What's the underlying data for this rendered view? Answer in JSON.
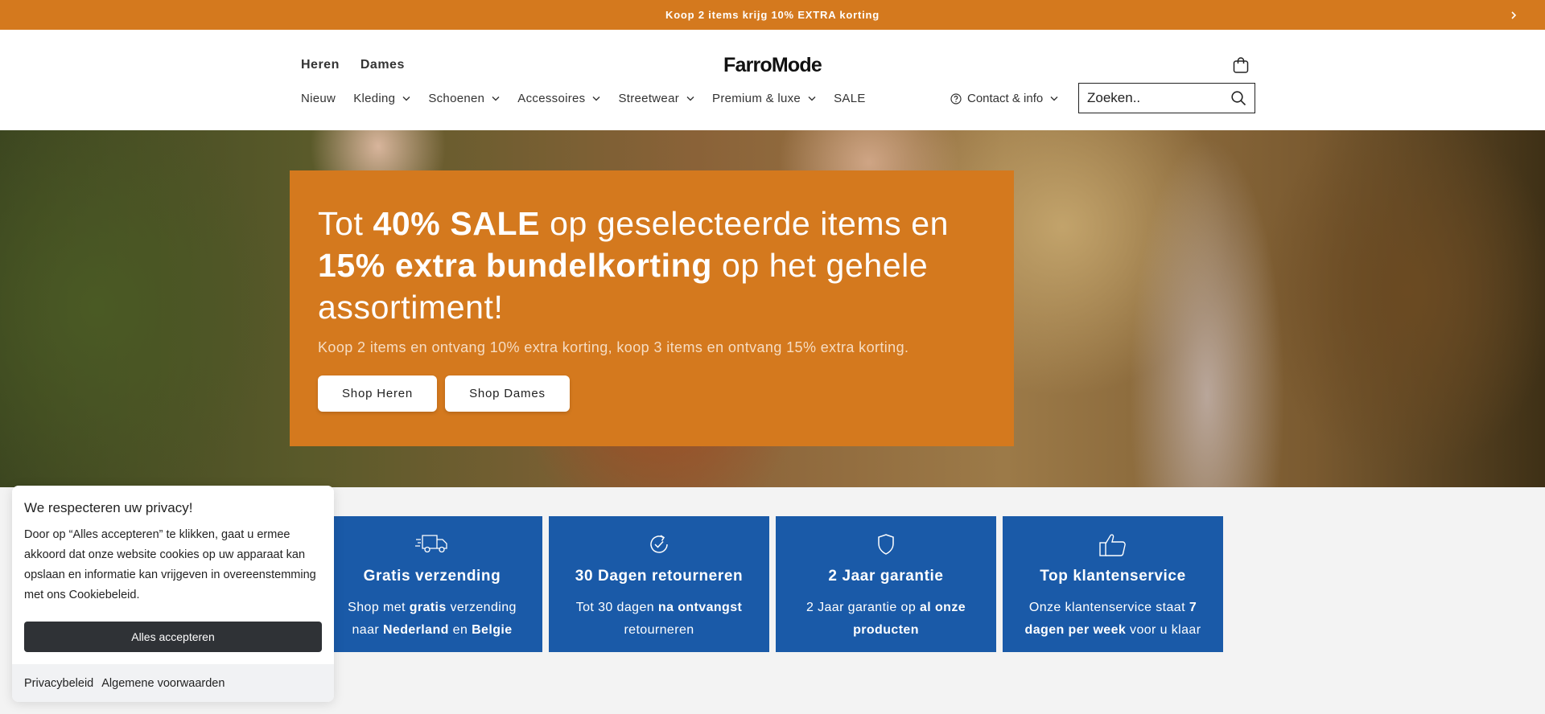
{
  "announcement": {
    "text": "Koop 2 items krijg 10% EXTRA korting",
    "next_icon": "chevron-right-icon"
  },
  "header": {
    "gender_links": [
      "Heren",
      "Dames"
    ],
    "logo": "FarroMode",
    "nav": [
      "Nieuw",
      "Kleding",
      "Schoenen",
      "Accessoires",
      "Streetwear",
      "Premium & luxe",
      "SALE"
    ],
    "contact": "Contact & info",
    "search": {
      "placeholder": "Zoeken.."
    }
  },
  "hero": {
    "headline": {
      "part1": "Tot ",
      "bold1": "40% SALE",
      "part2": " op geselecteerde items en ",
      "bold2": "15% extra bundelkorting",
      "part3": " op het gehele assortiment!"
    },
    "subtext": "Koop 2 items en ontvang 10% extra korting, koop 3 items en ontvang 15% extra korting.",
    "buttons": [
      "Shop Heren",
      "Shop Dames"
    ]
  },
  "features": [
    {
      "icon": "delivery-truck-icon",
      "title": "Gratis verzending",
      "desc": [
        [
          "Shop met ",
          false
        ],
        [
          "gratis",
          true
        ],
        [
          " verzending naar ",
          false
        ],
        [
          "Nederland",
          true
        ],
        [
          " en ",
          false
        ],
        [
          "Belgie",
          true
        ]
      ]
    },
    {
      "icon": "return-check-icon",
      "title": "30 Dagen retourneren",
      "desc": [
        [
          "Tot 30 dagen ",
          false
        ],
        [
          "na ontvangst",
          true
        ],
        [
          " retourneren",
          false
        ]
      ]
    },
    {
      "icon": "shield-icon",
      "title": "2 Jaar garantie",
      "desc": [
        [
          "2 Jaar garantie op ",
          false
        ],
        [
          "al onze producten",
          true
        ]
      ]
    },
    {
      "icon": "thumbs-up-icon",
      "title": "Top klantenservice",
      "desc": [
        [
          "Onze klantenservice staat ",
          false
        ],
        [
          "7 dagen per week",
          true
        ],
        [
          " voor u klaar",
          false
        ]
      ]
    }
  ],
  "cookie": {
    "title": "We respecteren uw privacy!",
    "text": "Door op “Alles accepteren” te klikken, gaat u ermee akkoord dat onze website cookies op uw apparaat kan opslaan en informatie kan vrijgeven in overeenstemming met ons Cookiebeleid.",
    "accept": "Alles accepteren",
    "links": [
      "Privacybeleid",
      "Algemene voorwaarden"
    ]
  },
  "colors": {
    "accent": "#d4791e",
    "feature_blue": "#1a5aa8",
    "cookie_button": "#2f3236"
  }
}
